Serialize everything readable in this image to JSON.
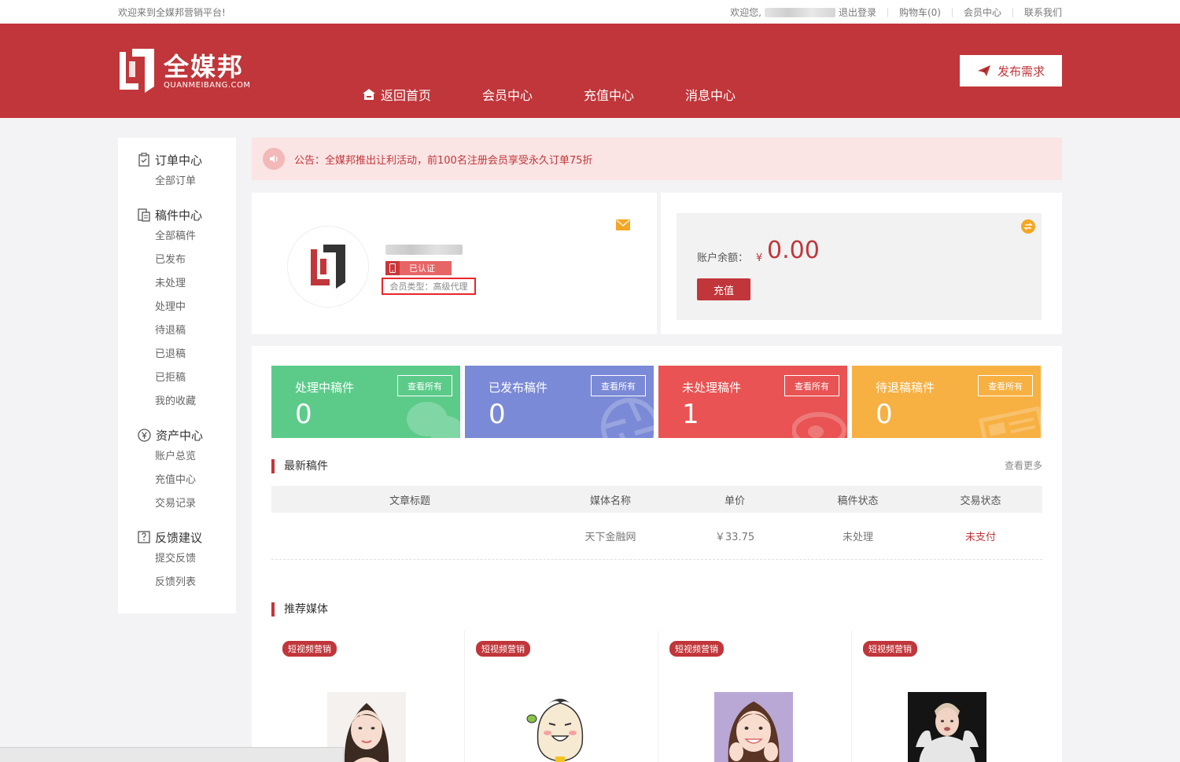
{
  "topbar": {
    "welcome": "欢迎来到全媒邦营销平台!",
    "greeting": "欢迎您,",
    "logout": "退出登录",
    "cart": "购物车(0)",
    "member_center": "会员中心",
    "contact": "联系我们"
  },
  "header": {
    "logo_cn": "全媒邦",
    "logo_en": "QUANMEIBANG.COM",
    "nav": [
      "返回首页",
      "会员中心",
      "充值中心",
      "消息中心"
    ],
    "publish": "发布需求",
    "brand_color": "#c0363a"
  },
  "sidebar": {
    "groups": [
      {
        "title": "订单中心",
        "icon": "clipboard-icon",
        "items": [
          "全部订单"
        ]
      },
      {
        "title": "稿件中心",
        "icon": "document-icon",
        "items": [
          "全部稿件",
          "已发布",
          "未处理",
          "处理中",
          "待退稿",
          "已退稿",
          "已拒稿",
          "我的收藏"
        ]
      },
      {
        "title": "资产中心",
        "icon": "yen-icon",
        "items": [
          "账户总览",
          "充值中心",
          "交易记录"
        ]
      },
      {
        "title": "反馈建议",
        "icon": "feedback-icon",
        "items": [
          "提交反馈",
          "反馈列表"
        ]
      }
    ]
  },
  "notice": {
    "text": "公告：全媒邦推出让利活动，前100名注册会员享受永久订单75折"
  },
  "profile": {
    "verified": "已认证",
    "member_type": "会员类型：高级代理"
  },
  "balance": {
    "label": "账户余额：",
    "currency": "¥",
    "value": "0.00",
    "recharge": "充值"
  },
  "stats": [
    {
      "title": "处理中稿件",
      "value": "0",
      "btn": "查看所有",
      "color": "#5ccb8a"
    },
    {
      "title": "已发布稿件",
      "value": "0",
      "btn": "查看所有",
      "color": "#7b8ad6"
    },
    {
      "title": "未处理稿件",
      "value": "1",
      "btn": "查看所有",
      "color": "#e95353"
    },
    {
      "title": "待退稿稿件",
      "value": "0",
      "btn": "查看所有",
      "color": "#f7b042"
    }
  ],
  "latest": {
    "title": "最新稿件",
    "more": "查看更多",
    "columns": [
      "文章标题",
      "媒体名称",
      "单价",
      "稿件状态",
      "交易状态"
    ],
    "rows": [
      {
        "title": "",
        "media": "天下金融网",
        "price": "￥33.75",
        "status": "未处理",
        "trade": "未支付"
      }
    ]
  },
  "recommend": {
    "title": "推荐媒体",
    "cards": [
      {
        "tag": "短视频营销"
      },
      {
        "tag": "短视频营销"
      },
      {
        "tag": "短视频营销"
      },
      {
        "tag": "短视频营销"
      }
    ]
  }
}
